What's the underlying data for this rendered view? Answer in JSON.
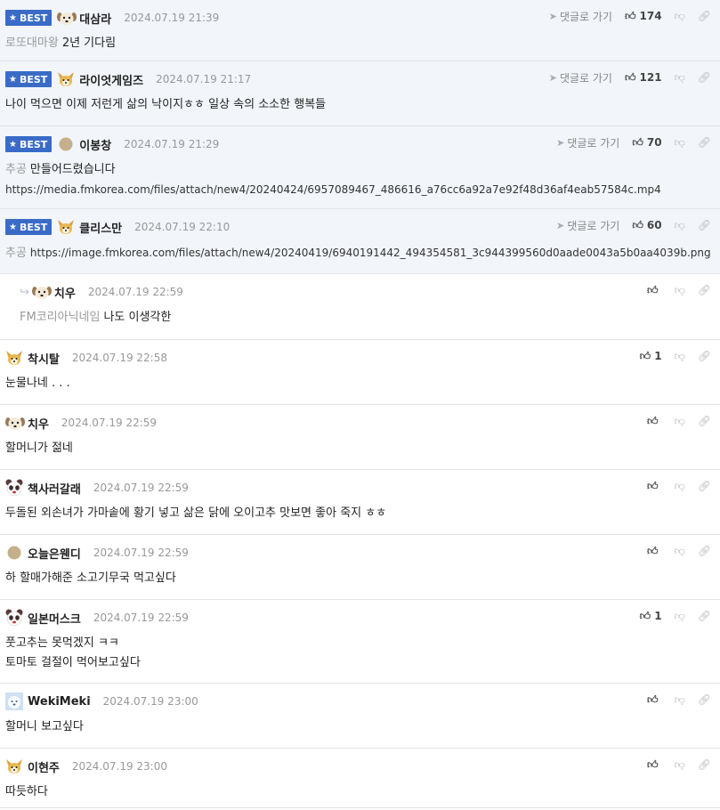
{
  "badge_label": "BEST",
  "goto_label": "댓글로 가기",
  "comments": [
    {
      "best": true,
      "avatar": "dog-avatar",
      "name": "대삼라",
      "date": "2024.07.19 21:39",
      "votes": "174",
      "mention": "로또대마왕",
      "lines": [
        "2년 기다림"
      ]
    },
    {
      "best": true,
      "avatar": "fox-avatar",
      "name": "라이엇게임즈",
      "date": "2024.07.19 21:17",
      "votes": "121",
      "mention": "",
      "lines": [
        "나이 먹으면 이제 저런게 삶의 낙이지ㅎㅎ 일상 속의 소소한 행복들"
      ]
    },
    {
      "best": true,
      "avatar": "circle-avatar",
      "name": "이봉창",
      "date": "2024.07.19 21:29",
      "votes": "70",
      "mention": "추공",
      "lines": [
        "만들어드렸습니다",
        "https://media.fmkorea.com/files/attach/new4/20240424/6957089467_486616_a76cc6a92a7e92f48d36af4eab57584c.mp4"
      ]
    },
    {
      "best": true,
      "avatar": "fox-avatar",
      "name": "클리스만",
      "date": "2024.07.19 22:10",
      "votes": "60",
      "mention": "추공",
      "lines": [
        "https://image.fmkorea.com/files/attach/new4/20240419/6940191442_494354581_3c944399560d0aade0043a5b0aa4039b.png"
      ]
    },
    {
      "reply": true,
      "avatar": "dog-avatar",
      "name": "치우",
      "date": "2024.07.19 22:59",
      "votes": "",
      "mention": "FM코리아닉네임",
      "lines": [
        "나도 이생각한"
      ]
    },
    {
      "avatar": "fox-avatar",
      "name": "착시탈",
      "date": "2024.07.19 22:58",
      "votes": "1",
      "mention": "",
      "lines": [
        "눈물나네 . . ."
      ]
    },
    {
      "avatar": "dog-avatar",
      "name": "치우",
      "date": "2024.07.19 22:59",
      "votes": "",
      "mention": "",
      "lines": [
        "할머니가 젊네"
      ]
    },
    {
      "avatar": "panda-avatar",
      "name": "책사러갈래",
      "date": "2024.07.19 22:59",
      "votes": "",
      "mention": "",
      "lines": [
        "두돌된 외손녀가 가마솥에 황기 넣고 삶은 닭에 오이고추 맛보면 좋아 죽지 ㅎㅎ"
      ]
    },
    {
      "avatar": "circle-avatar",
      "name": "오늘은웬디",
      "date": "2024.07.19 22:59",
      "votes": "",
      "mention": "",
      "lines": [
        "하 할매가해준 소고기무국 먹고싶다"
      ]
    },
    {
      "avatar": "panda-avatar",
      "name": "일본머스크",
      "date": "2024.07.19 22:59",
      "votes": "1",
      "mention": "",
      "lines": [
        "풋고추는 못먹겠지 ㅋㅋ",
        "토마토 걸절이 먹어보고싶다"
      ]
    },
    {
      "avatar": "bear-avatar",
      "name": "WekiMeki",
      "date": "2024.07.19 23:00",
      "votes": "",
      "mention": "",
      "lines": [
        "할머니 보고싶다"
      ]
    },
    {
      "avatar": "fox-avatar",
      "name": "이현주",
      "date": "2024.07.19 23:00",
      "votes": "",
      "mention": "",
      "lines": [
        "따듯하다"
      ]
    }
  ]
}
